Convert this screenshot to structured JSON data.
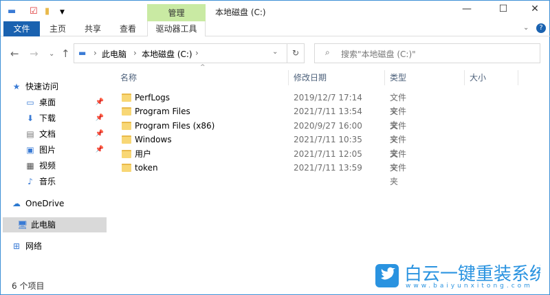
{
  "window": {
    "title": "本地磁盘 (C:)",
    "context_tab": "管理",
    "context_subtab": "驱动器工具"
  },
  "ribbon": {
    "tabs": [
      "文件",
      "主页",
      "共享",
      "查看"
    ]
  },
  "address": {
    "crumbs": [
      "此电脑",
      "本地磁盘 (C:)"
    ]
  },
  "search": {
    "placeholder": "搜索\"本地磁盘 (C:)\""
  },
  "sidebar": {
    "items": [
      {
        "label": "快速访问",
        "icon": "star-icon",
        "pinned": false
      },
      {
        "label": "桌面",
        "icon": "desktop-icon",
        "pinned": true
      },
      {
        "label": "下载",
        "icon": "download-icon",
        "pinned": true
      },
      {
        "label": "文档",
        "icon": "document-icon",
        "pinned": true
      },
      {
        "label": "图片",
        "icon": "picture-icon",
        "pinned": true
      },
      {
        "label": "视频",
        "icon": "video-icon",
        "pinned": false
      },
      {
        "label": "音乐",
        "icon": "music-icon",
        "pinned": false
      },
      {
        "label": "OneDrive",
        "icon": "cloud-icon",
        "pinned": false
      },
      {
        "label": "此电脑",
        "icon": "computer-icon",
        "pinned": false
      },
      {
        "label": "网络",
        "icon": "network-icon",
        "pinned": false
      }
    ]
  },
  "columns": [
    "名称",
    "修改日期",
    "类型",
    "大小"
  ],
  "files": [
    {
      "name": "PerfLogs",
      "date": "2019/12/7 17:14",
      "type": "文件夹"
    },
    {
      "name": "Program Files",
      "date": "2021/7/11 13:54",
      "type": "文件夹"
    },
    {
      "name": "Program Files (x86)",
      "date": "2020/9/27 16:00",
      "type": "文件夹"
    },
    {
      "name": "Windows",
      "date": "2021/7/11 10:35",
      "type": "文件夹"
    },
    {
      "name": "用户",
      "date": "2021/7/11 12:05",
      "type": "文件夹"
    },
    {
      "name": "token",
      "date": "2021/7/11 13:59",
      "type": "文件夹"
    }
  ],
  "status": {
    "count": "6 个项目"
  },
  "watermark": {
    "title": "白云一键重装系统",
    "url": "www.baiyunxitong.com"
  },
  "colors": {
    "accent": "#1a62b0",
    "context": "#c9eaa3"
  }
}
